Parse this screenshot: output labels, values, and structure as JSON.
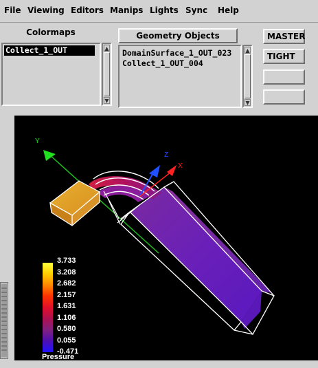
{
  "menubar": {
    "items": [
      "File",
      "Viewing",
      "Editors",
      "Manips",
      "Lights",
      "Sync",
      "Help"
    ]
  },
  "colormaps": {
    "title": "Colormaps",
    "items": [
      "Collect_1_OUT"
    ],
    "selected_index": 0
  },
  "geometry": {
    "title": "Geometry Objects",
    "items": [
      "DomainSurface_1_OUT_023",
      "Collect_1_OUT_004"
    ]
  },
  "side_buttons": {
    "master": "MASTER",
    "tight": "TIGHT",
    "blank1": "",
    "blank2": ""
  },
  "viewer": {
    "axes": {
      "x": "X",
      "y": "Y",
      "z": "Z"
    },
    "axis_colors": {
      "x": "#ff2020",
      "y": "#20e020",
      "z": "#2050ff"
    },
    "legend": {
      "title": "Pressure",
      "ticks": [
        "3.733",
        "3.208",
        "2.682",
        "2.157",
        "1.631",
        "1.106",
        "0.580",
        "0.055",
        "-0.471"
      ],
      "gradient": [
        "#ffff40",
        "#ffcc00",
        "#ff8800",
        "#ff3300",
        "#e0102a",
        "#b01050",
        "#802080",
        "#5010b0",
        "#2010ff"
      ]
    }
  }
}
